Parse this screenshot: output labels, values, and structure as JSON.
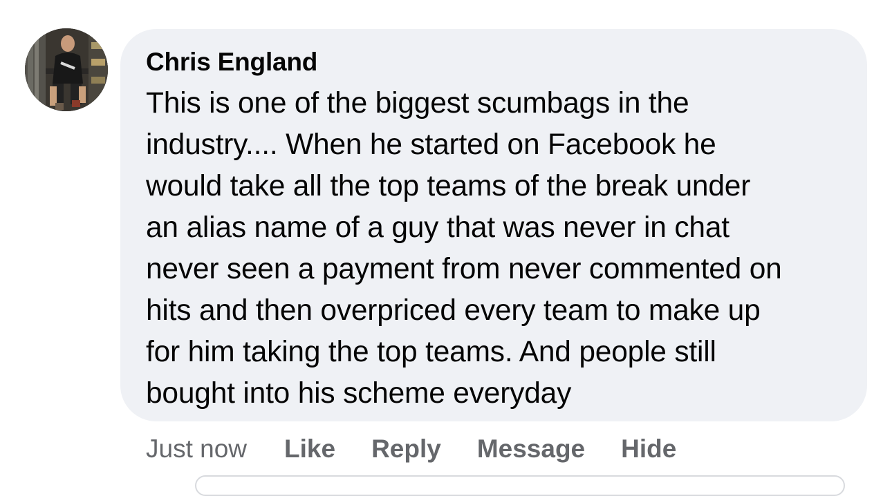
{
  "comment": {
    "author": "Chris England",
    "text": "This is one of the biggest scumbags in the\nindustry.... When he started on Facebook he\nwould take all the top teams of the break under\nan alias name of a guy that was never in chat\nnever seen a payment from never commented on\nhits and then overpriced every team to make up\nfor him taking the top teams. And people still\nbought into his scheme everyday",
    "timestamp": "Just now",
    "actions": {
      "like": "Like",
      "reply": "Reply",
      "message": "Message",
      "hide": "Hide"
    }
  },
  "colors": {
    "bubble_background": "#eff1f5",
    "text_primary": "#050505",
    "text_secondary": "#65676b"
  },
  "icons": {
    "avatar": "profile-photo"
  }
}
